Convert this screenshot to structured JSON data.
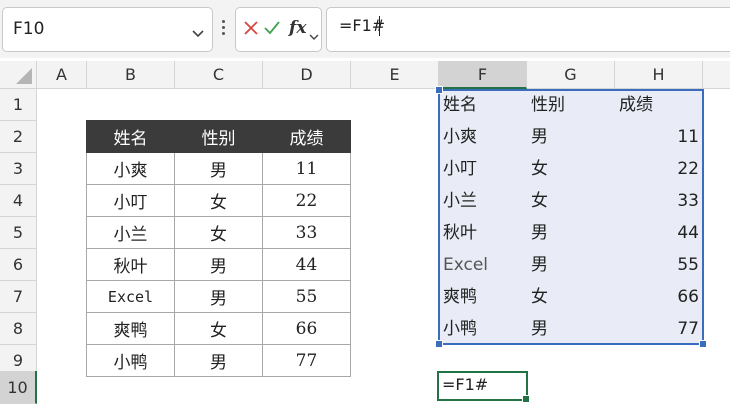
{
  "name_box": {
    "value": "F10"
  },
  "formula_bar": {
    "value": "=F1#",
    "fx_label": "fx"
  },
  "columns": [
    "A",
    "B",
    "C",
    "D",
    "E",
    "F",
    "G",
    "H"
  ],
  "rows": [
    "1",
    "2",
    "3",
    "4",
    "5",
    "6",
    "7",
    "8",
    "9",
    "10"
  ],
  "source_table": {
    "headers": [
      "姓名",
      "性别",
      "成绩"
    ],
    "rows": [
      [
        "小爽",
        "男",
        "11"
      ],
      [
        "小叮",
        "女",
        "22"
      ],
      [
        "小兰",
        "女",
        "33"
      ],
      [
        "秋叶",
        "男",
        "44"
      ],
      [
        "Excel",
        "男",
        "55"
      ],
      [
        "爽鸭",
        "女",
        "66"
      ],
      [
        "小鸭",
        "男",
        "77"
      ]
    ]
  },
  "spill_range": {
    "headers": [
      "姓名",
      "性别",
      "成绩"
    ],
    "rows": [
      [
        "小爽",
        "男",
        "11"
      ],
      [
        "小叮",
        "女",
        "22"
      ],
      [
        "小兰",
        "女",
        "33"
      ],
      [
        "秋叶",
        "男",
        "44"
      ],
      [
        "Excel",
        "男",
        "55"
      ],
      [
        "爽鸭",
        "女",
        "66"
      ],
      [
        "小鸭",
        "男",
        "77"
      ]
    ]
  },
  "active_cell": {
    "formula": "=F1#"
  },
  "colors": {
    "selection_green": "#217346",
    "spill_border": "#3a6dbd",
    "spill_fill": "#e9ecf6",
    "header_fill": "#3b3b3b"
  }
}
